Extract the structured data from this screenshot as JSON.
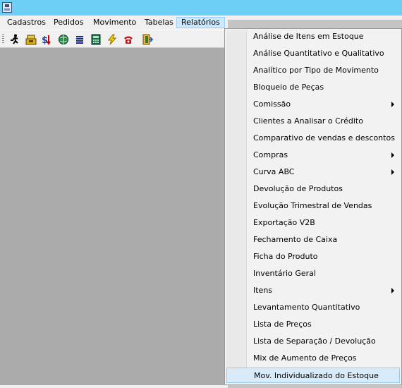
{
  "menubar": {
    "items": [
      {
        "label": "Cadastros"
      },
      {
        "label": "Pedidos"
      },
      {
        "label": "Movimento"
      },
      {
        "label": "Tabelas"
      },
      {
        "label": "Relatórios"
      }
    ],
    "active_index": 4
  },
  "toolbar": {
    "icons": [
      "running-man-icon",
      "cash-register-icon",
      "dollar-arrows-icon",
      "globe-icon",
      "list-icon",
      "calculator-icon",
      "lightning-icon",
      "telephone-icon",
      "exit-door-icon"
    ]
  },
  "colors": {
    "titlebar": "#6ecff6",
    "workspace": "#ababab",
    "highlight": "#d9ebf9"
  },
  "menu": {
    "items": [
      {
        "label": "Análise de Itens em Estoque",
        "submenu": false
      },
      {
        "label": "Análise Quantitativo e Qualitativo",
        "submenu": false
      },
      {
        "label": "Analítico por Tipo de Movimento",
        "submenu": false
      },
      {
        "label": "Bloqueio de  Peças",
        "submenu": false
      },
      {
        "label": "Comissão",
        "submenu": true
      },
      {
        "label": "Clientes a  Analisar o Crédito",
        "submenu": false
      },
      {
        "label": "Comparativo de vendas e descontos",
        "submenu": false
      },
      {
        "label": "Compras",
        "submenu": true
      },
      {
        "label": "Curva ABC",
        "submenu": true
      },
      {
        "label": "Devolução de Produtos",
        "submenu": false
      },
      {
        "label": "Evolução Trimestral de Vendas",
        "submenu": false
      },
      {
        "label": "Exportação V2B",
        "submenu": false
      },
      {
        "label": "Fechamento de Caixa",
        "submenu": false
      },
      {
        "label": "Ficha do Produto",
        "submenu": false
      },
      {
        "label": "Inventário Geral",
        "submenu": false
      },
      {
        "label": "Itens",
        "submenu": true
      },
      {
        "label": "Levantamento Quantitativo",
        "submenu": false
      },
      {
        "label": "Lista de Preços",
        "submenu": false
      },
      {
        "label": "Lista de Separação / Devolução",
        "submenu": false
      },
      {
        "label": "Mix de Aumento de Preços",
        "submenu": false
      },
      {
        "label": "Mov. Individualizado do Estoque",
        "submenu": false
      }
    ],
    "highlighted_index": 20
  }
}
